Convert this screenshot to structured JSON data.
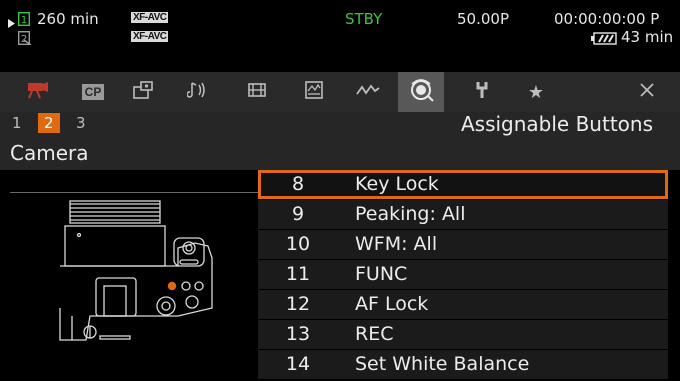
{
  "status": {
    "media_duration": "260 min",
    "format_badge_1": "XF-AVC",
    "format_badge_2": "XF-AVC",
    "record_state": "STBY",
    "frame_rate": "50.00P",
    "timecode": "00:00:00:00 P",
    "battery_remaining": "43 min",
    "colors": {
      "state": "#3ec43e",
      "text": "#e8e8e8"
    }
  },
  "tabs": [
    {
      "icon": "movie-camera-icon",
      "active": false
    },
    {
      "icon": "custom-picture-icon",
      "label": "CP",
      "active": false
    },
    {
      "icon": "picture-settings-icon",
      "active": false
    },
    {
      "icon": "audio-icon",
      "active": false
    },
    {
      "icon": "recording-media-icon",
      "active": false
    },
    {
      "icon": "monitoring-icon",
      "active": false
    },
    {
      "icon": "waveform-icon",
      "active": false
    },
    {
      "icon": "assignable-buttons-icon",
      "active": true
    },
    {
      "icon": "wrench-icon",
      "active": false
    },
    {
      "icon": "star-icon",
      "active": false
    }
  ],
  "pages": {
    "items": [
      "1",
      "2",
      "3"
    ],
    "current": "2",
    "accent": "#e06a12"
  },
  "menu_title": "Assignable Buttons",
  "section_label": "Camera",
  "buttons": [
    {
      "number": "8",
      "function": "Key Lock",
      "selected": true
    },
    {
      "number": "9",
      "function": "Peaking: All",
      "selected": false
    },
    {
      "number": "10",
      "function": "WFM: All",
      "selected": false
    },
    {
      "number": "11",
      "function": "FUNC",
      "selected": false
    },
    {
      "number": "12",
      "function": "AF Lock",
      "selected": false
    },
    {
      "number": "13",
      "function": "REC",
      "selected": false
    },
    {
      "number": "14",
      "function": "Set White Balance",
      "selected": false
    }
  ]
}
